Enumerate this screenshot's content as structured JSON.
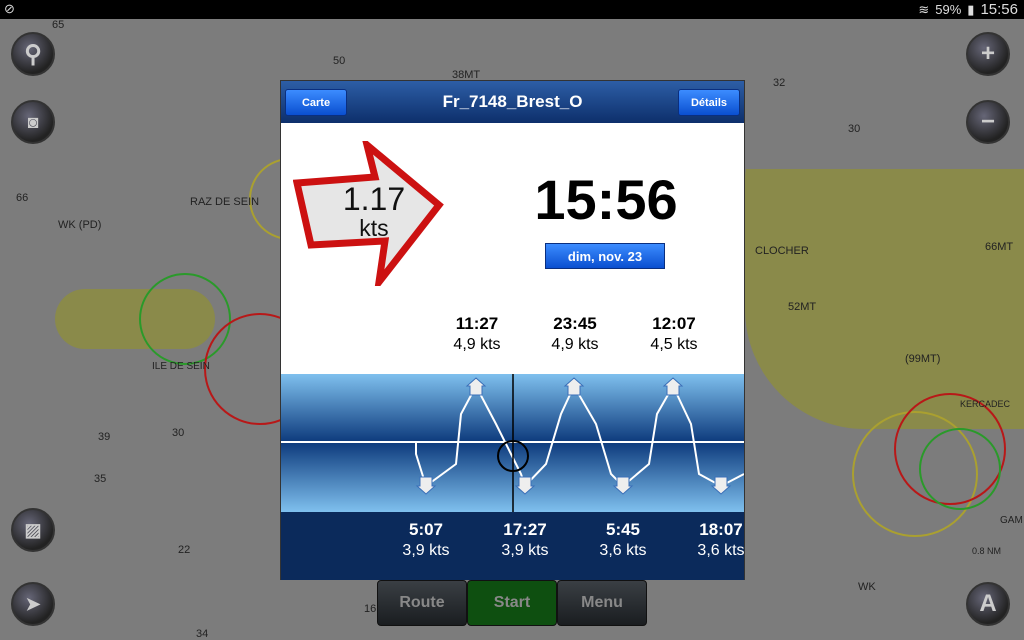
{
  "status": {
    "battery": "59%",
    "clock": "15:56"
  },
  "map": {
    "labels": [
      "65",
      "50",
      "38MT",
      "30",
      "32",
      "30",
      "66",
      "RAZ DE SEIN",
      "WK (PD)",
      "CLOCHER",
      "52MT",
      "66MT",
      "(99MT)",
      "ILE DE SEIN",
      "39",
      "30",
      "35",
      "22",
      "34",
      "16",
      "WK",
      "KERCADEC",
      "GAM",
      "0.8 NM"
    ]
  },
  "dialog": {
    "title": "Fr_7148_Brest_O",
    "left_button": "Carte",
    "right_button": "Détails",
    "current_speed": "1.17",
    "current_unit": "kts",
    "current_direction": "east",
    "arrow_color": "#cc1111",
    "time": "15:56",
    "date": "dim, nov. 23",
    "highs": [
      {
        "time": "11:27",
        "speed": "4,9 kts"
      },
      {
        "time": "23:45",
        "speed": "4,9 kts"
      },
      {
        "time": "12:07",
        "speed": "4,5 kts"
      }
    ],
    "lows": [
      {
        "time": "5:07",
        "speed": "3,9 kts"
      },
      {
        "time": "17:27",
        "speed": "3,9 kts"
      },
      {
        "time": "5:45",
        "speed": "3,6 kts"
      },
      {
        "time": "18:07",
        "speed": "3,6 kts"
      }
    ]
  },
  "toolbar": {
    "route": "Route",
    "start": "Start",
    "menu": "Menu"
  }
}
